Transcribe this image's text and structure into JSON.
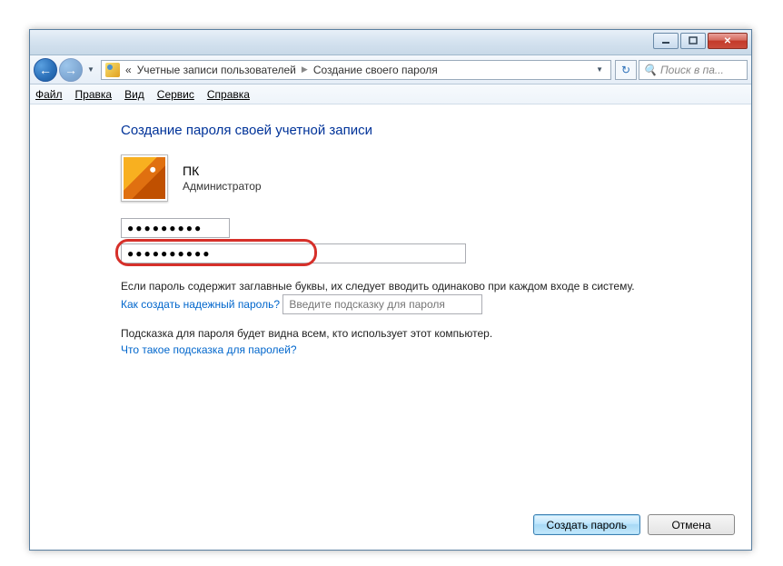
{
  "address": {
    "prefix": "«",
    "crumb1": "Учетные записи пользователей",
    "crumb2": "Создание своего пароля"
  },
  "search": {
    "placeholder": "Поиск в па..."
  },
  "menu": {
    "file": "Файл",
    "edit": "Правка",
    "view": "Вид",
    "tools": "Сервис",
    "help": "Справка"
  },
  "heading": "Создание пароля своей учетной записи",
  "user": {
    "name": "ПК",
    "role": "Администратор"
  },
  "fields": {
    "password1_value": "●●●●●●●●●",
    "password2_value": "●●●●●●●●●●",
    "hint_placeholder": "Введите подсказку для пароля"
  },
  "notes": {
    "caps": "Если пароль содержит заглавные буквы, их следует вводить одинаково при каждом входе в систему.",
    "strong_link": "Как создать надежный пароль?",
    "hint_note": "Подсказка для пароля будет видна всем, кто использует этот компьютер.",
    "hint_link": "Что такое подсказка для паролей?"
  },
  "buttons": {
    "create": "Создать пароль",
    "cancel": "Отмена"
  }
}
